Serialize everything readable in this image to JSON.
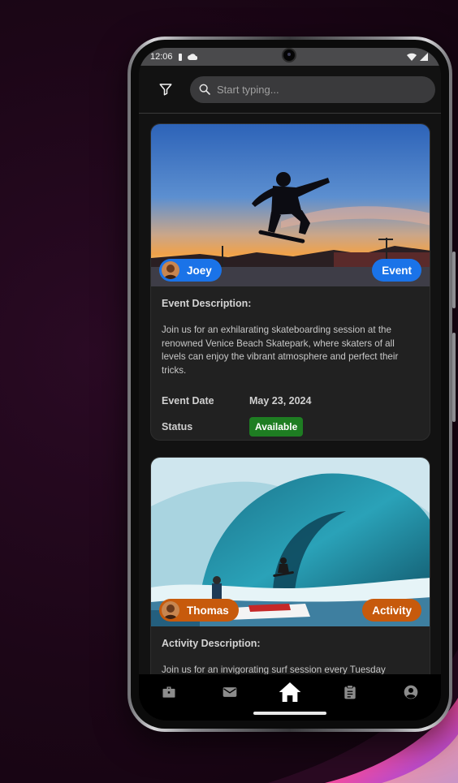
{
  "status_bar": {
    "time": "12:06"
  },
  "search": {
    "placeholder": "Start typing..."
  },
  "cards": [
    {
      "user": "Joey",
      "type": "Event",
      "type_color": "#1a73e8",
      "description_label": "Event Description:",
      "description": "Join us for an exhilarating skateboarding session at the renowned Venice Beach Skatepark, where skaters of all levels can enjoy the vibrant atmosphere and perfect their tricks.",
      "date_label": "Event Date",
      "date": "May 23, 2024",
      "status_label": "Status",
      "status": "Available"
    },
    {
      "user": "Thomas",
      "type": "Activity",
      "type_color": "#c75a0c",
      "description_label": "Activity Description:",
      "description": "Join us for an invigorating surf session every Tuesday"
    }
  ],
  "nav": {
    "items": [
      "briefcase-icon",
      "mail-icon",
      "home-icon",
      "clipboard-icon",
      "account-icon"
    ],
    "active": "home-icon"
  },
  "colors": {
    "accent_blue": "#1a73e8",
    "accent_orange": "#c75a0c",
    "status_green": "#1e7d22"
  }
}
